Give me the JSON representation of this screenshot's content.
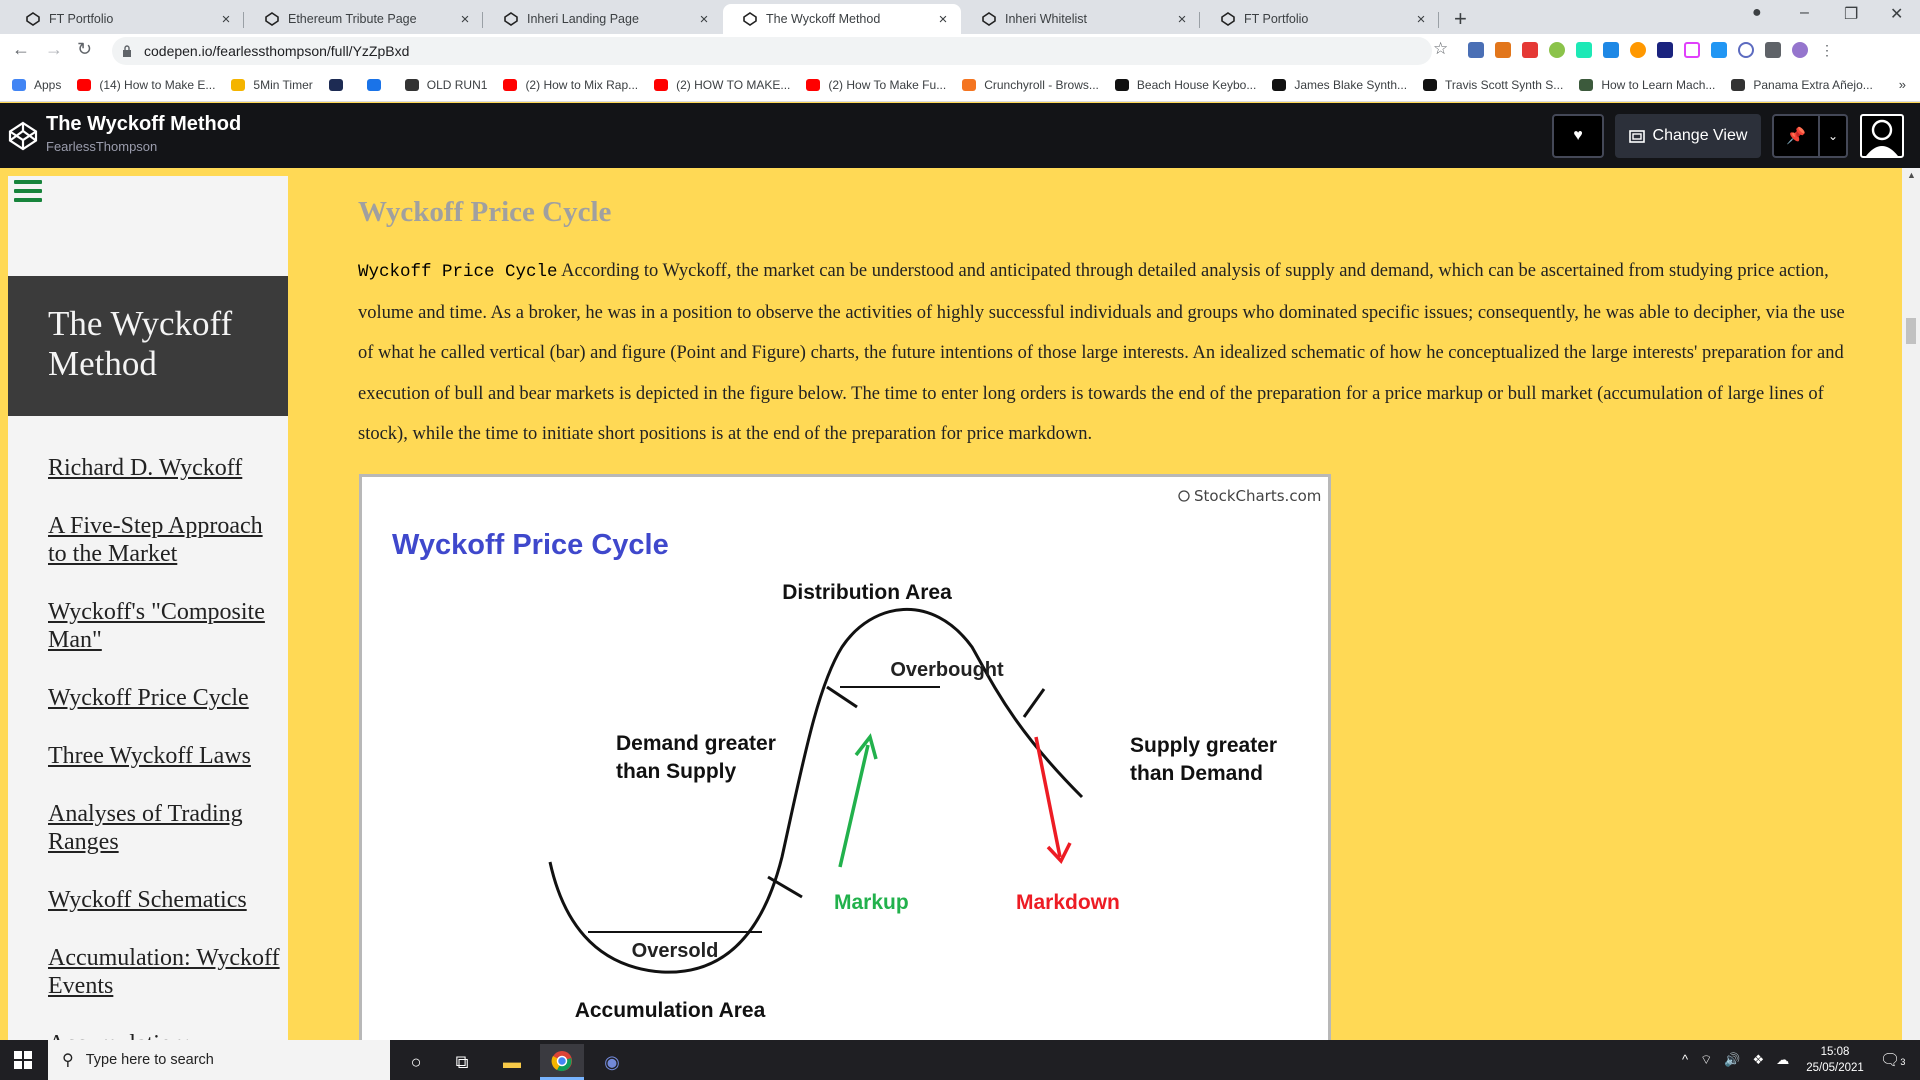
{
  "browser": {
    "tabs": [
      {
        "title": "FT Portfolio",
        "active": false
      },
      {
        "title": "Ethereum Tribute Page",
        "active": false
      },
      {
        "title": "Inheri Landing Page",
        "active": false
      },
      {
        "title": "The Wyckoff Method",
        "active": true
      },
      {
        "title": "Inheri Whitelist",
        "active": false
      },
      {
        "title": "FT Portfolio",
        "active": false
      }
    ],
    "url": "codepen.io/fearlessthompson/full/YzZpBxd",
    "bookmarks": [
      {
        "label": "Apps",
        "color": "#4285f4"
      },
      {
        "label": "(14) How to Make E...",
        "color": "#ff0000"
      },
      {
        "label": "5Min Timer",
        "color": "#f4b400"
      },
      {
        "label": "",
        "color": "#1d2b53"
      },
      {
        "label": "",
        "color": "#1a73e8"
      },
      {
        "label": "OLD RUN1",
        "color": "#333333"
      },
      {
        "label": "(2) How to Mix Rap...",
        "color": "#ff0000"
      },
      {
        "label": "(2) HOW TO MAKE...",
        "color": "#ff0000"
      },
      {
        "label": "(2) How To Make Fu...",
        "color": "#ff0000"
      },
      {
        "label": "Crunchyroll - Brows...",
        "color": "#f47521"
      },
      {
        "label": "Beach House Keybo...",
        "color": "#111111"
      },
      {
        "label": "James Blake Synth...",
        "color": "#111111"
      },
      {
        "label": "Travis Scott Synth S...",
        "color": "#111111"
      },
      {
        "label": "How to Learn Mach...",
        "color": "#3c5a3c"
      },
      {
        "label": "Panama Extra Añejo...",
        "color": "#333333"
      }
    ],
    "bookmarks_more": "»"
  },
  "codepen": {
    "title": "The Wyckoff Method",
    "author": "FearlessThompson",
    "change_view": "Change View"
  },
  "sidebar": {
    "title": "The Wyckoff Method",
    "links": [
      "Richard D. Wyckoff",
      "A Five-Step Approach to the Market",
      "Wyckoff's \"Composite Man\"",
      "Wyckoff Price Cycle",
      "Three Wyckoff Laws",
      "Analyses of Trading Ranges",
      "Wyckoff Schematics",
      "Accumulation: Wyckoff Events",
      "Accumulation:"
    ]
  },
  "main": {
    "heading": "Wyckoff Price Cycle",
    "code_label": "Wyckoff Price Cycle",
    "paragraph": "According to Wyckoff, the market can be understood and anticipated through detailed analysis of supply and demand, which can be ascertained from studying price action, volume and time. As a broker, he was in a position to observe the activities of highly successful individuals and groups who dominated specific issues; consequently, he was able to decipher, via the use of what he called vertical (bar) and figure (Point and Figure) charts, the future intentions of those large interests. An idealized schematic of how he conceptualized the large interests' preparation for and execution of bull and bear markets is depicted in the figure below. The time to enter long orders is towards the end of the preparation for a price markup or bull market (accumulation of large lines of stock), while the time to initiate short positions is at the end of the preparation for price markdown."
  },
  "figure": {
    "credit": "StockCharts.com",
    "title": "Wyckoff Price Cycle",
    "distribution": "Distribution Area",
    "overbought": "Overbought",
    "demand_1": "Demand greater",
    "demand_2": "than Supply",
    "supply_1": "Supply greater",
    "supply_2": "than Demand",
    "markup": "Markup",
    "markdown": "Markdown",
    "oversold": "Oversold",
    "accumulation": "Accumulation Area",
    "colors": {
      "title": "#3f48cc",
      "markup": "#22b14c",
      "markdown": "#ed1c24"
    }
  },
  "taskbar": {
    "search_placeholder": "Type here to search",
    "time": "15:08",
    "date": "25/05/2021",
    "notification_count": "3"
  }
}
